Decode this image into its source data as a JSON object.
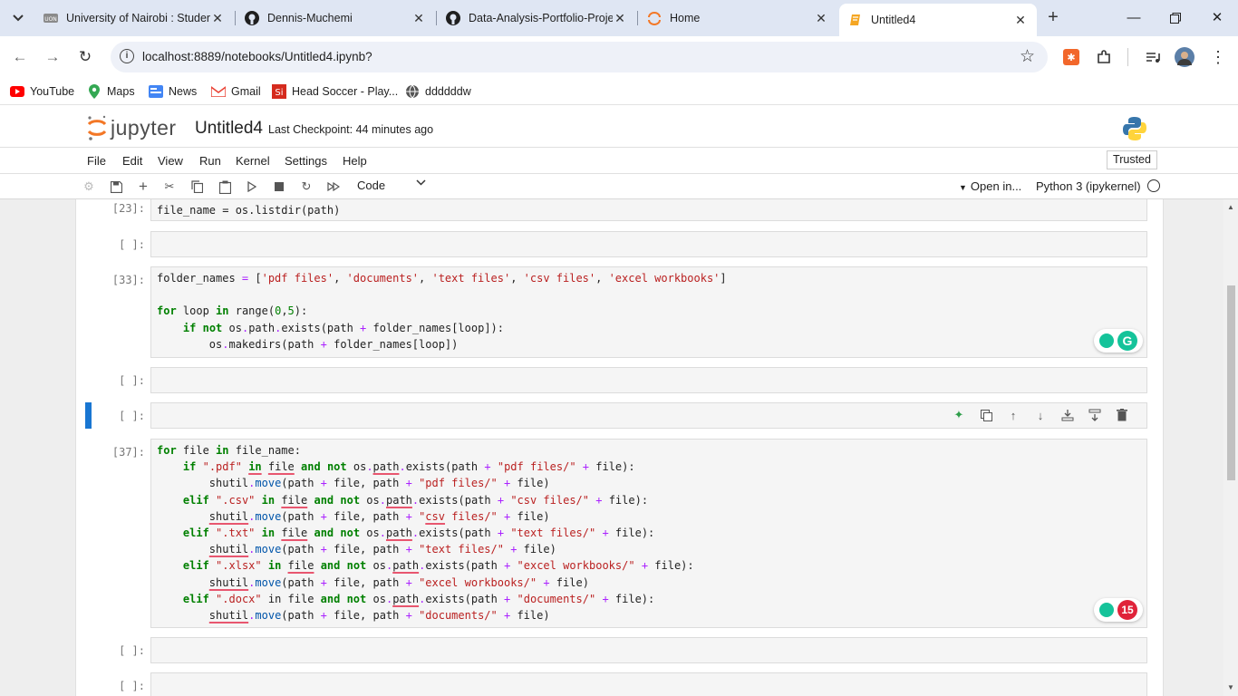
{
  "browser": {
    "tabs": [
      {
        "title": "University of Nairobi : Studer",
        "favicon": "uon-icon"
      },
      {
        "title": "Dennis-Muchemi",
        "favicon": "github-icon"
      },
      {
        "title": "Data-Analysis-Portfolio-Proje",
        "favicon": "github-icon"
      },
      {
        "title": "Home",
        "favicon": "jupyter-icon"
      },
      {
        "title": "Untitled4",
        "favicon": "notebook-icon"
      }
    ],
    "url": "localhost:8889/notebooks/Untitled4.ipynb?",
    "bookmarks": [
      {
        "label": "YouTube"
      },
      {
        "label": "Maps"
      },
      {
        "label": "News"
      },
      {
        "label": "Gmail"
      },
      {
        "label": "Head Soccer - Play..."
      },
      {
        "label": "ddddddw"
      }
    ]
  },
  "jupyter": {
    "logo_text": "jupyter",
    "notebook_name": "Untitled4",
    "checkpoint": "Last Checkpoint: 44 minutes ago",
    "trusted": "Trusted",
    "menu": [
      "File",
      "Edit",
      "Run",
      "Kernel",
      "Settings",
      "Help"
    ],
    "menu_view": "View",
    "cell_type": "Code",
    "open_in": "Open in...",
    "kernel_name": "Python 3 (ipykernel)"
  },
  "cells": {
    "c1": {
      "prompt": "[23]:"
    },
    "c2": {
      "prompt": "[ ]:"
    },
    "c3": {
      "prompt": "[33]:"
    },
    "c4": {
      "prompt": "[ ]:"
    },
    "c5": {
      "prompt": "[ ]:"
    },
    "c6": {
      "prompt": "[37]:"
    },
    "c7": {
      "prompt": "[ ]:"
    },
    "c8": {
      "prompt": "[ ]:"
    }
  },
  "grammarly": {
    "count_a": "15"
  },
  "colors": {
    "accent": "#1976d2",
    "grammarly": "#15c39a",
    "grammarly_alert": "#e0233a"
  }
}
